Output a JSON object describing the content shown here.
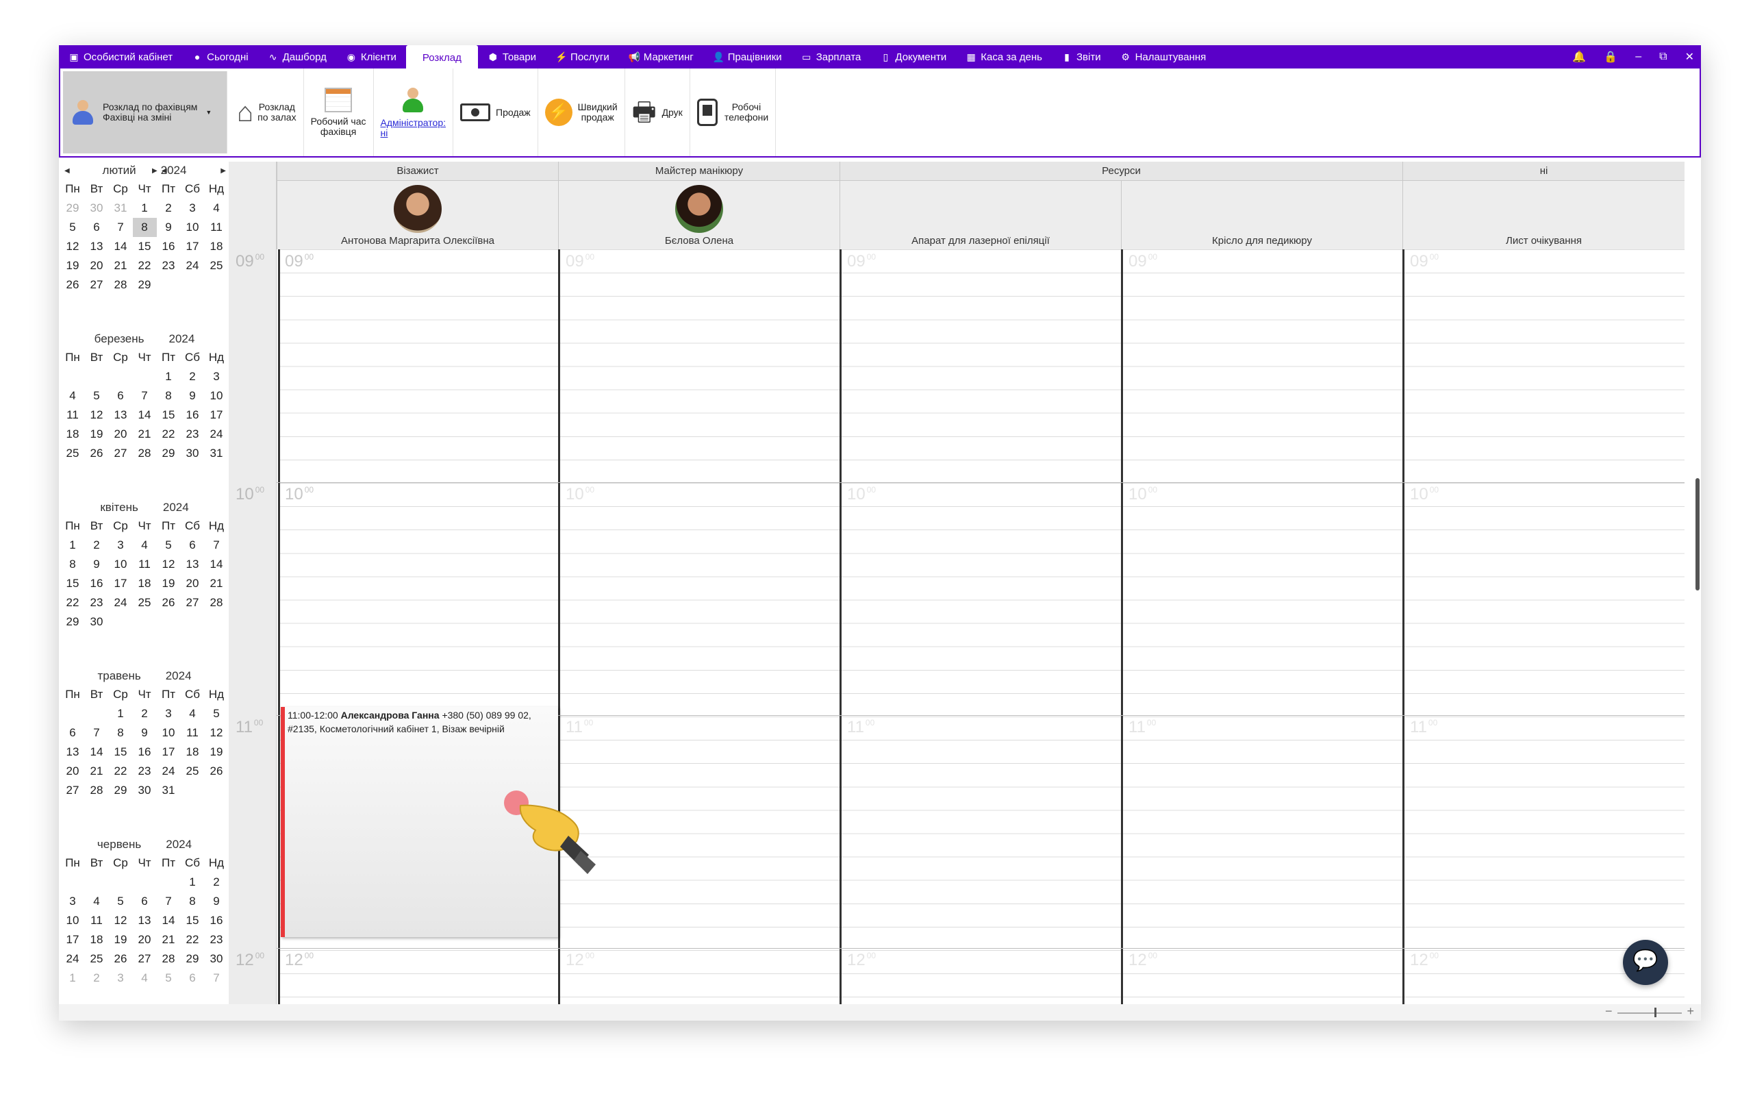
{
  "nav": {
    "items": [
      {
        "icon": "cabinet-icon",
        "glyph": "▣",
        "label": "Особистий кабінет"
      },
      {
        "icon": "today-icon",
        "glyph": "●",
        "label": "Сьогодні"
      },
      {
        "icon": "dashboard-icon",
        "glyph": "∿",
        "label": "Дашборд"
      },
      {
        "icon": "clients-icon",
        "glyph": "◉",
        "label": "Клієнти"
      },
      {
        "icon": "",
        "glyph": "",
        "label": "Розклад",
        "active": true
      },
      {
        "icon": "goods-icon",
        "glyph": "⬢",
        "label": "Товари"
      },
      {
        "icon": "services-icon",
        "glyph": "⚡",
        "label": "Послуги"
      },
      {
        "icon": "marketing-icon",
        "glyph": "📢",
        "label": "Маркетинг"
      },
      {
        "icon": "staff-icon",
        "glyph": "👤",
        "label": "Працівники"
      },
      {
        "icon": "salary-icon",
        "glyph": "▭",
        "label": "Зарплата"
      },
      {
        "icon": "documents-icon",
        "glyph": "▯",
        "label": "Документи"
      },
      {
        "icon": "cash-icon",
        "glyph": "▦",
        "label": "Каса за день"
      },
      {
        "icon": "reports-icon",
        "glyph": "▮",
        "label": "Звіти"
      },
      {
        "icon": "settings-icon",
        "glyph": "⚙",
        "label": "Налаштування"
      }
    ],
    "controls": {
      "bell": "🔔",
      "lock": "🔒",
      "minimize": "–",
      "restore": "⧉",
      "close": "✕"
    }
  },
  "toolbar": {
    "schedule_by_specialists_1": "Розклад по фахівцям",
    "schedule_by_specialists_2": "Фахівці на зміні",
    "schedule_by_halls_1": "Розклад",
    "schedule_by_halls_2": "по залах",
    "working_time_1": "Робочий час",
    "working_time_2": "фахівця",
    "administrator_1": "Адміністратор:",
    "administrator_2": "ні",
    "sale": "Продаж",
    "quick_sale_1": "Швидкий",
    "quick_sale_2": "продаж",
    "print": "Друк",
    "work_phones_1": "Робочі",
    "work_phones_2": "телефони"
  },
  "minicalendar": {
    "weekdays": [
      "Пн",
      "Вт",
      "Ср",
      "Чт",
      "Пт",
      "Сб",
      "Нд"
    ],
    "months": [
      {
        "name": "лютий",
        "year": "2024",
        "arrows": true,
        "selected": "8",
        "days": [
          "29",
          "30",
          "31",
          "1",
          "2",
          "3",
          "4",
          "5",
          "6",
          "7",
          "8",
          "9",
          "10",
          "11",
          "12",
          "13",
          "14",
          "15",
          "16",
          "17",
          "18",
          "19",
          "20",
          "21",
          "22",
          "23",
          "24",
          "25",
          "26",
          "27",
          "28",
          "29",
          "",
          "",
          "",
          "",
          "",
          ""
        ],
        "muted": [
          0,
          1,
          2
        ]
      },
      {
        "name": "березень",
        "year": "2024",
        "days": [
          "",
          "",
          "",
          "",
          "1",
          "2",
          "3",
          "4",
          "5",
          "6",
          "7",
          "8",
          "9",
          "10",
          "11",
          "12",
          "13",
          "14",
          "15",
          "16",
          "17",
          "18",
          "19",
          "20",
          "21",
          "22",
          "23",
          "24",
          "25",
          "26",
          "27",
          "28",
          "29",
          "30",
          "31"
        ],
        "muted": []
      },
      {
        "name": "квітень",
        "year": "2024",
        "days": [
          "1",
          "2",
          "3",
          "4",
          "5",
          "6",
          "7",
          "8",
          "9",
          "10",
          "11",
          "12",
          "13",
          "14",
          "15",
          "16",
          "17",
          "18",
          "19",
          "20",
          "21",
          "22",
          "23",
          "24",
          "25",
          "26",
          "27",
          "28",
          "29",
          "30"
        ],
        "muted": []
      },
      {
        "name": "травень",
        "year": "2024",
        "days": [
          "",
          "",
          "1",
          "2",
          "3",
          "4",
          "5",
          "6",
          "7",
          "8",
          "9",
          "10",
          "11",
          "12",
          "13",
          "14",
          "15",
          "16",
          "17",
          "18",
          "19",
          "20",
          "21",
          "22",
          "23",
          "24",
          "25",
          "26",
          "27",
          "28",
          "29",
          "30",
          "31"
        ],
        "muted": []
      },
      {
        "name": "червень",
        "year": "2024",
        "days": [
          "",
          "",
          "",
          "",
          "",
          "1",
          "2",
          "3",
          "4",
          "5",
          "6",
          "7",
          "8",
          "9",
          "10",
          "11",
          "12",
          "13",
          "14",
          "15",
          "16",
          "17",
          "18",
          "19",
          "20",
          "21",
          "22",
          "23",
          "24",
          "25",
          "26",
          "27",
          "28",
          "29",
          "30",
          "1",
          "2",
          "3",
          "4",
          "5",
          "6",
          "7"
        ],
        "muted": [
          35,
          36,
          37,
          38,
          39,
          40,
          41
        ]
      }
    ]
  },
  "schedule": {
    "groups": [
      "Візажист",
      "Майстер манікюру",
      "Ресурси",
      "ні"
    ],
    "resources": [
      "Антонова Маргарита Олексіївна",
      "Бєлова Олена",
      "Апарат для лазерної епіляції",
      "Крісло для педикюру",
      "Лист очікування"
    ],
    "hours": [
      "09",
      "10",
      "11",
      "12"
    ],
    "minutes": "00",
    "appointment": {
      "time": "11:00-12:00",
      "client": "Александрова Ганна",
      "phone": "+380 (50) 089 99 02,",
      "details": "#2135, Косметологічний кабінет 1, Візаж вечірній"
    }
  },
  "colors": {
    "accent": "#5a00c8",
    "appointment_bar": "#e8383b"
  }
}
